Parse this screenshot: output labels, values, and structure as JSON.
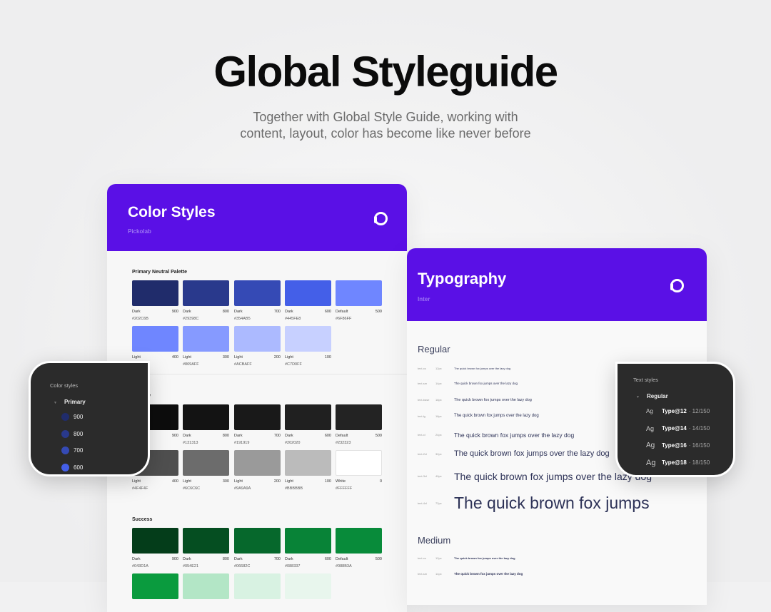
{
  "hero": {
    "title": "Global Styleguide",
    "subtitle_line1": "Together with Global Style Guide, working with",
    "subtitle_line2": "content, layout, color has become like never before"
  },
  "color_card": {
    "title": "Color Styles",
    "subtitle": "Pickolab",
    "logo": "pickolab-logo",
    "sections": [
      {
        "name": "Primary Neutral Palette",
        "swatches": [
          {
            "label": "Dark",
            "weight": "900",
            "hex": "#202C6B"
          },
          {
            "label": "Dark",
            "weight": "800",
            "hex": "#29398C"
          },
          {
            "label": "Dark",
            "weight": "700",
            "hex": "#354AB5"
          },
          {
            "label": "Dark",
            "weight": "600",
            "hex": "#445FE8"
          },
          {
            "label": "Default",
            "weight": "500",
            "hex": "#6F86FF"
          },
          {
            "label": "Light",
            "weight": "400",
            "hex": "#6F86FF"
          },
          {
            "label": "Light",
            "weight": "300",
            "hex": "#869AFF"
          },
          {
            "label": "Light",
            "weight": "200",
            "hex": "#ACBAFF"
          },
          {
            "label": "Light",
            "weight": "100",
            "hex": "#C7D0FF"
          }
        ]
      },
      {
        "name": "Primary",
        "swatches": [
          {
            "label": "Dark",
            "weight": "900",
            "hex": "#0D0D0D"
          },
          {
            "label": "Dark",
            "weight": "800",
            "hex": "#131313"
          },
          {
            "label": "Dark",
            "weight": "700",
            "hex": "#191919"
          },
          {
            "label": "Dark",
            "weight": "600",
            "hex": "#202020"
          },
          {
            "label": "Default",
            "weight": "500",
            "hex": "#232323"
          },
          {
            "label": "Light",
            "weight": "400",
            "hex": "#4F4F4F"
          },
          {
            "label": "Light",
            "weight": "300",
            "hex": "#6C6C6C"
          },
          {
            "label": "Light",
            "weight": "200",
            "hex": "#9A9A9A"
          },
          {
            "label": "Light",
            "weight": "100",
            "hex": "#BBBBBB"
          },
          {
            "label": "White",
            "weight": "0",
            "hex": "#FFFFFF"
          }
        ]
      },
      {
        "name": "Success",
        "swatches": [
          {
            "label": "Dark",
            "weight": "900",
            "hex": "#043D1A"
          },
          {
            "label": "Dark",
            "weight": "800",
            "hex": "#054E21"
          },
          {
            "label": "Dark",
            "weight": "700",
            "hex": "#06682C"
          },
          {
            "label": "Dark",
            "weight": "600",
            "hex": "#088337"
          },
          {
            "label": "Default",
            "weight": "500",
            "hex": "#088B3A"
          },
          {
            "color": "#0A9B3E"
          },
          {
            "color": "#B3E6C6"
          },
          {
            "color": "#D8F2E2"
          },
          {
            "color": "#E8F6ED"
          }
        ]
      }
    ]
  },
  "typography_card": {
    "title": "Typography",
    "subtitle": "Inter",
    "logo": "pickolab-logo",
    "sample": "The quick brown fox jumps over the lazy dog",
    "sample_short": "The quick brown fox jumps",
    "regular_heading": "Regular",
    "medium_heading": "Medium",
    "regular_rows": [
      {
        "token": "text-xs",
        "size": "12px"
      },
      {
        "token": "text-sm",
        "size": "14px"
      },
      {
        "token": "text-base",
        "size": "16px"
      },
      {
        "token": "text-lg",
        "size": "18px"
      },
      {
        "token": "text-xl",
        "size": "24px"
      },
      {
        "token": "text-2xl",
        "size": "32px"
      },
      {
        "token": "text-3xl",
        "size": "40px"
      },
      {
        "token": "text-4xl",
        "size": "72px"
      }
    ],
    "medium_rows": [
      {
        "token": "text-xs",
        "size": "12px"
      },
      {
        "token": "text-sm",
        "size": "14px"
      }
    ]
  },
  "color_panel": {
    "title": "Color styles",
    "group": "Primary",
    "items": [
      {
        "label": "900",
        "color": "#202C6B"
      },
      {
        "label": "800",
        "color": "#29398C"
      },
      {
        "label": "700",
        "color": "#354AB5"
      },
      {
        "label": "600",
        "color": "#445FE8"
      }
    ]
  },
  "text_panel": {
    "title": "Text styles",
    "group": "Regular",
    "sample": "Ag",
    "items": [
      {
        "name": "Type@12",
        "meta": "· 12/150"
      },
      {
        "name": "Type@14",
        "meta": "· 14/150"
      },
      {
        "name": "Type@16",
        "meta": "· 16/150"
      },
      {
        "name": "Type@18",
        "meta": "· 18/150"
      }
    ]
  }
}
